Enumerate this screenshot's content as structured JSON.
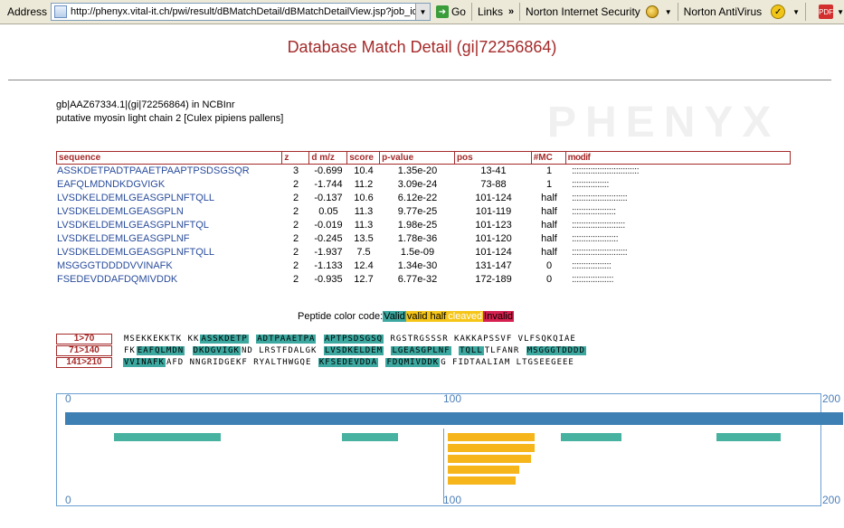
{
  "browser": {
    "address_label": "Address",
    "url": "http://phenyx.vital-it.ch/pwi/result/dBMatchDetail/dBMatchDetailView.jsp?job_id=",
    "go_label": "Go",
    "links_label": "Links",
    "norton_security": "Norton Internet Security",
    "norton_antivirus": "Norton AntiVirus"
  },
  "watermark": "PHENYX",
  "page": {
    "title": "Database Match Detail (gi|72256864)",
    "accession_line": "gb|AAZ67334.1|(gi|72256864) in NCBInr",
    "description_line": "putative myosin light chain 2 [Culex pipiens pallens]"
  },
  "table": {
    "headers": {
      "sequence": "sequence",
      "z": "z",
      "dmz": "d m/z",
      "score": "score",
      "pvalue": "p-value",
      "pos": "pos",
      "mc": "#MC",
      "modif": "modif"
    },
    "rows": [
      {
        "seq": "ASSKDETPADTPAAETPAAPTPSDSGSQR",
        "z": "3",
        "dmz": "-0.699",
        "score": "10.4",
        "pvalue": "1.35e-20",
        "pos": "13-41",
        "mc": "1",
        "modif": ":::::::::::::::::::::::::::::"
      },
      {
        "seq": "EAFQLMDNDKDGVIGK",
        "z": "2",
        "dmz": "-1.744",
        "score": "11.2",
        "pvalue": "3.09e-24",
        "pos": "73-88",
        "mc": "1",
        "modif": "::::::::::::::::"
      },
      {
        "seq": "LVSDKELDEMLGEASGPLNFTQLL",
        "z": "2",
        "dmz": "-0.137",
        "score": "10.6",
        "pvalue": "6.12e-22",
        "pos": "101-124",
        "mc": "half",
        "modif": "::::::::::::::::::::::::"
      },
      {
        "seq": "LVSDKELDEMLGEASGPLN",
        "z": "2",
        "dmz": "0.05",
        "score": "11.3",
        "pvalue": "9.77e-25",
        "pos": "101-119",
        "mc": "half",
        "modif": ":::::::::::::::::::"
      },
      {
        "seq": "LVSDKELDEMLGEASGPLNFTQL",
        "z": "2",
        "dmz": "-0.019",
        "score": "11.3",
        "pvalue": "1.98e-25",
        "pos": "101-123",
        "mc": "half",
        "modif": ":::::::::::::::::::::::"
      },
      {
        "seq": "LVSDKELDEMLGEASGPLNF",
        "z": "2",
        "dmz": "-0.245",
        "score": "13.5",
        "pvalue": "1.78e-36",
        "pos": "101-120",
        "mc": "half",
        "modif": "::::::::::::::::::::"
      },
      {
        "seq": "LVSDKELDEMLGEASGPLNFTQLL",
        "z": "2",
        "dmz": "-1.937",
        "score": "7.5",
        "pvalue": "1.5e-09",
        "pos": "101-124",
        "mc": "half",
        "modif": "::::::::::::::::::::::::"
      },
      {
        "seq": "MSGGGTDDDDVVINAFK",
        "z": "2",
        "dmz": "-1.133",
        "score": "12.4",
        "pvalue": "1.34e-30",
        "pos": "131-147",
        "mc": "0",
        "modif": ":::::::::::::::::"
      },
      {
        "seq": "FSEDEVDDAFDQMIVDDK",
        "z": "2",
        "dmz": "-0.935",
        "score": "12.7",
        "pvalue": "6.77e-32",
        "pos": "172-189",
        "mc": "0",
        "modif": "::::::::::::::::::"
      }
    ]
  },
  "legend": {
    "prefix": "Peptide color code:",
    "valid": "Valid",
    "half": "valid half",
    "cleaved": " cleaved",
    "invalid": "Invalid"
  },
  "sequence_rows": [
    {
      "label": "1>70",
      "segments": [
        {
          "t": "MSEKKEKKTK KK",
          "valid": false
        },
        {
          "t": "ASSKDETP",
          "valid": true
        },
        {
          "t": " ",
          "valid": false
        },
        {
          "t": "ADTPAAETPA",
          "valid": true
        },
        {
          "t": " ",
          "valid": false
        },
        {
          "t": "APTPSDSGSQ",
          "valid": true
        },
        {
          "t": " RGSTRGSSSR KAKKAPSSVF VLFSQKQIAE",
          "valid": false
        }
      ]
    },
    {
      "label": "71>140",
      "segments": [
        {
          "t": "FK",
          "valid": false
        },
        {
          "t": "EAFQLMDN",
          "valid": true
        },
        {
          "t": " ",
          "valid": false
        },
        {
          "t": "DKDGVIGK",
          "valid": true
        },
        {
          "t": "ND LRSTFDALGK ",
          "valid": false
        },
        {
          "t": "LVSDKELDEM",
          "valid": true
        },
        {
          "t": " ",
          "valid": false
        },
        {
          "t": "LGEASGPLNF",
          "valid": true
        },
        {
          "t": " ",
          "valid": false
        },
        {
          "t": "TQLL",
          "valid": true
        },
        {
          "t": "TLFANR ",
          "valid": false
        },
        {
          "t": "MSGGGTDDDD",
          "valid": true
        }
      ]
    },
    {
      "label": "141>210",
      "segments": [
        {
          "t": "VVINAFK",
          "valid": true
        },
        {
          "t": "AFD NNGRIDGEKF RYALTHWGQE ",
          "valid": false
        },
        {
          "t": "KFSEDEVDDA",
          "valid": true
        },
        {
          "t": " ",
          "valid": false
        },
        {
          "t": "FDQMIVDDK",
          "valid": true
        },
        {
          "t": "G FIDTAALIAM LTGSEEGEEE",
          "valid": false
        }
      ]
    }
  ],
  "coverage_map": {
    "ticks": [
      "0",
      "100",
      "200"
    ],
    "protein_length": 200,
    "hits": [
      {
        "start": 13,
        "end": 41,
        "row": 0,
        "type": "valid"
      },
      {
        "start": 73,
        "end": 88,
        "row": 0,
        "type": "valid"
      },
      {
        "start": 131,
        "end": 147,
        "row": 0,
        "type": "valid"
      },
      {
        "start": 172,
        "end": 189,
        "row": 0,
        "type": "valid"
      },
      {
        "start": 101,
        "end": 124,
        "row": 0,
        "type": "half"
      },
      {
        "start": 101,
        "end": 124,
        "row": 1,
        "type": "half"
      },
      {
        "start": 101,
        "end": 123,
        "row": 2,
        "type": "half"
      },
      {
        "start": 101,
        "end": 120,
        "row": 3,
        "type": "half"
      },
      {
        "start": 101,
        "end": 119,
        "row": 4,
        "type": "half"
      }
    ],
    "colors": {
      "protein": "#3e7fb4",
      "valid": "#48b2a0",
      "half": "#f5b51b"
    }
  }
}
